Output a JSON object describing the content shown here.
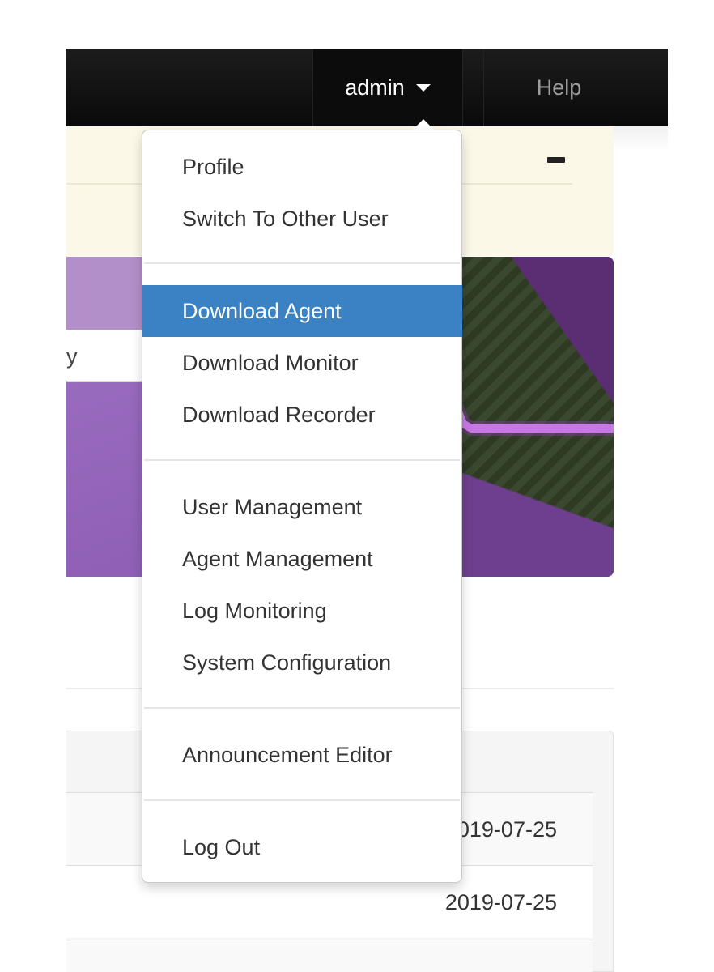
{
  "navbar": {
    "user_label": "admin",
    "help_label": "Help"
  },
  "search": {
    "visible_text": "y"
  },
  "list": {
    "rows": [
      {
        "date": "2019-07-25"
      },
      {
        "date": "2019-07-25"
      }
    ]
  },
  "dropdown": {
    "items": [
      {
        "label": "Profile"
      },
      {
        "label": "Switch To Other User"
      },
      {
        "label": "Download Agent"
      },
      {
        "label": "Download Monitor"
      },
      {
        "label": "Download Recorder"
      },
      {
        "label": "User Management"
      },
      {
        "label": "Agent Management"
      },
      {
        "label": "Log Monitoring"
      },
      {
        "label": "System Configuration"
      },
      {
        "label": "Announcement Editor"
      },
      {
        "label": "Log Out"
      }
    ],
    "active_item": "Download Agent"
  },
  "colors": {
    "navbar": "#111111",
    "announcement_bg": "#fbf8e7",
    "banner_purple": "#8e5bb4",
    "highlight_blue": "#3a82c4",
    "pulse_line": "#c877e6"
  },
  "icons": {
    "user_menu_caret": "caret-down-icon",
    "announcement_collapse": "minus-icon"
  }
}
